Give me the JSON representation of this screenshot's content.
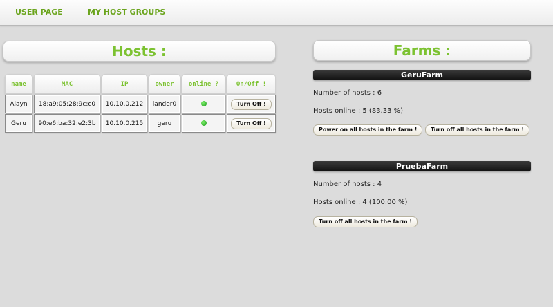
{
  "nav": {
    "user_page": "USER PAGE",
    "host_groups": "MY HOST GROUPS"
  },
  "hosts": {
    "title": "Hosts :",
    "columns": [
      "name",
      "MAC",
      "IP",
      "owner",
      "online ?",
      "On/Off !"
    ],
    "rows": [
      {
        "name": "Alayn",
        "mac": "18:a9:05:28:9c:c0",
        "ip": "10.10.0.212",
        "owner": "lander0",
        "online": true,
        "action": "Turn Off !"
      },
      {
        "name": "Geru",
        "mac": "90:e6:ba:32:e2:3b",
        "ip": "10.10.0.215",
        "owner": "geru",
        "online": true,
        "action": "Turn Off !"
      }
    ]
  },
  "farms": {
    "title": "Farms :",
    "items": [
      {
        "name": "GeruFarm",
        "num_hosts": "Number of hosts : 6",
        "hosts_online": "Hosts online : 5 (83.33 %)",
        "buttons": [
          "Power on all hosts in the farm !",
          "Turn off all hosts in the farm !"
        ]
      },
      {
        "name": "PruebaFarm",
        "num_hosts": "Number of hosts : 4",
        "hosts_online": "Hosts online : 4 (100.00 %)",
        "buttons": [
          "Turn off all hosts in the farm !"
        ]
      }
    ]
  },
  "colors": {
    "accent_green": "#7cc231",
    "nav_green": "#6aa41c",
    "online_dot": "#2fbf2f"
  }
}
